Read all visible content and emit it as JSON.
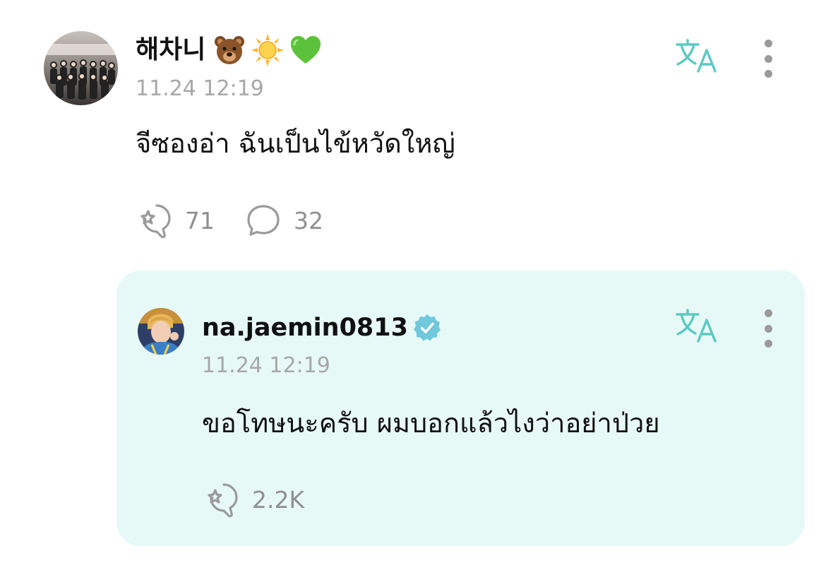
{
  "post": {
    "author_name": "해차니",
    "name_emojis": [
      "bear-emoji",
      "sun-emoji",
      "green-heart-emoji"
    ],
    "timestamp": "11.24 12:19",
    "text": "จีซองอ่า ฉันเป็นไข้หวัดใหญ่",
    "like_count": "71",
    "comment_count": "32"
  },
  "reply": {
    "author_name": "na.jaemin0813",
    "verified": true,
    "timestamp": "11.24 12:19",
    "text": "ขอโทษนะครับ ผมบอกแล้วไงว่าอย่าป่วย",
    "like_count": "2.2K"
  },
  "colors": {
    "accent": "#5cc9c2",
    "reply_background": "#e7f9f6",
    "muted_text": "#a7a7a7",
    "icon_gray": "#9a9a9a"
  },
  "icons": {
    "translate": "translate-icon",
    "more": "more-vertical-icon",
    "like": "like-icon",
    "comment": "comment-icon",
    "verified": "verified-badge-icon"
  }
}
